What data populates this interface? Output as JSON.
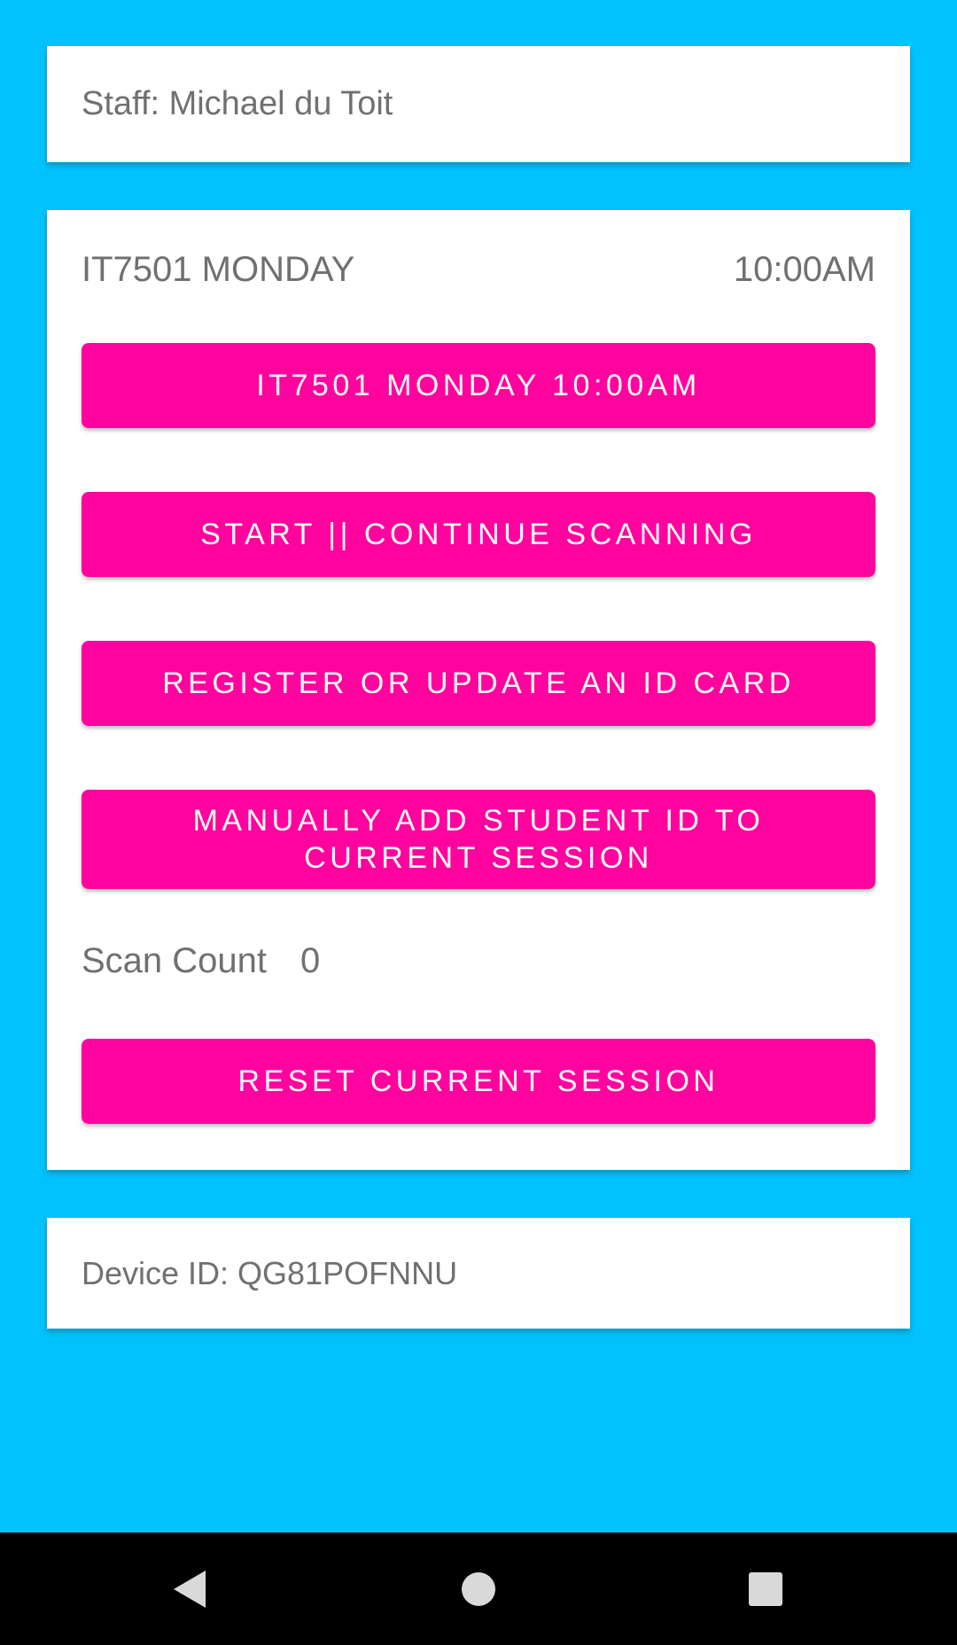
{
  "staff": {
    "label": "Staff: Michael du Toit"
  },
  "session": {
    "course": "IT7501 MONDAY",
    "time": "10:00AM",
    "session_button": "IT7501 MONDAY 10:00AM",
    "scan_button": "START || CONTINUE SCANNING",
    "register_button": "REGISTER OR UPDATE AN ID CARD",
    "manual_button": "MANUALLY ADD STUDENT ID TO CURRENT SESSION",
    "scan_count_label": "Scan Count",
    "scan_count_value": "0",
    "reset_button": "RESET CURRENT SESSION"
  },
  "device": {
    "label": "Device ID: QG81POFNNU"
  },
  "navbar": {
    "back_icon": "back-triangle-icon",
    "home_icon": "home-circle-icon",
    "recent_icon": "recents-square-icon"
  },
  "colors": {
    "background": "#00C2FC",
    "accent": "#FF039E",
    "card": "#FFFFFF",
    "text": "#707070"
  }
}
